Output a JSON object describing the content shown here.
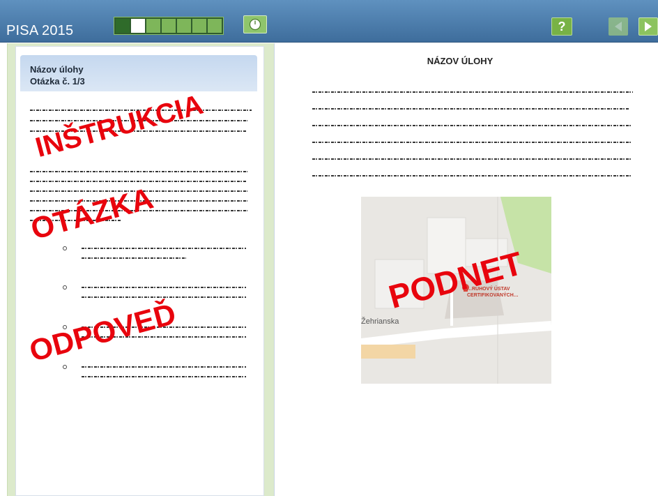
{
  "header": {
    "title": "PISA 2015",
    "progress_segments": [
      "done",
      "current",
      "todo",
      "todo",
      "todo",
      "todo",
      "todo"
    ],
    "timer_icon": "clock-icon",
    "help_label": "?",
    "prev_icon": "arrow-left-icon",
    "next_icon": "arrow-right-icon"
  },
  "question": {
    "title": "Názov úlohy",
    "subtitle": "Otázka č. 1/3"
  },
  "stimulus": {
    "title": "NÁZOV ÚLOHY",
    "map": {
      "street": "Žehrianska",
      "place_label": "…RUHOVÝ ÚSTAV CERTIFIKOVANÝCH…"
    }
  },
  "overlays": {
    "instruction": "INŠTRUKCIA",
    "question": "OTÁZKA",
    "answer": "ODPOVEĎ",
    "stimulus": "PODNET"
  },
  "colors": {
    "header_bar": "#4f80b0",
    "progress_done": "#2f6b2a",
    "progress_todo": "#7eb65a",
    "overlay_red": "#e8040d",
    "left_frame": "#dceacb"
  }
}
